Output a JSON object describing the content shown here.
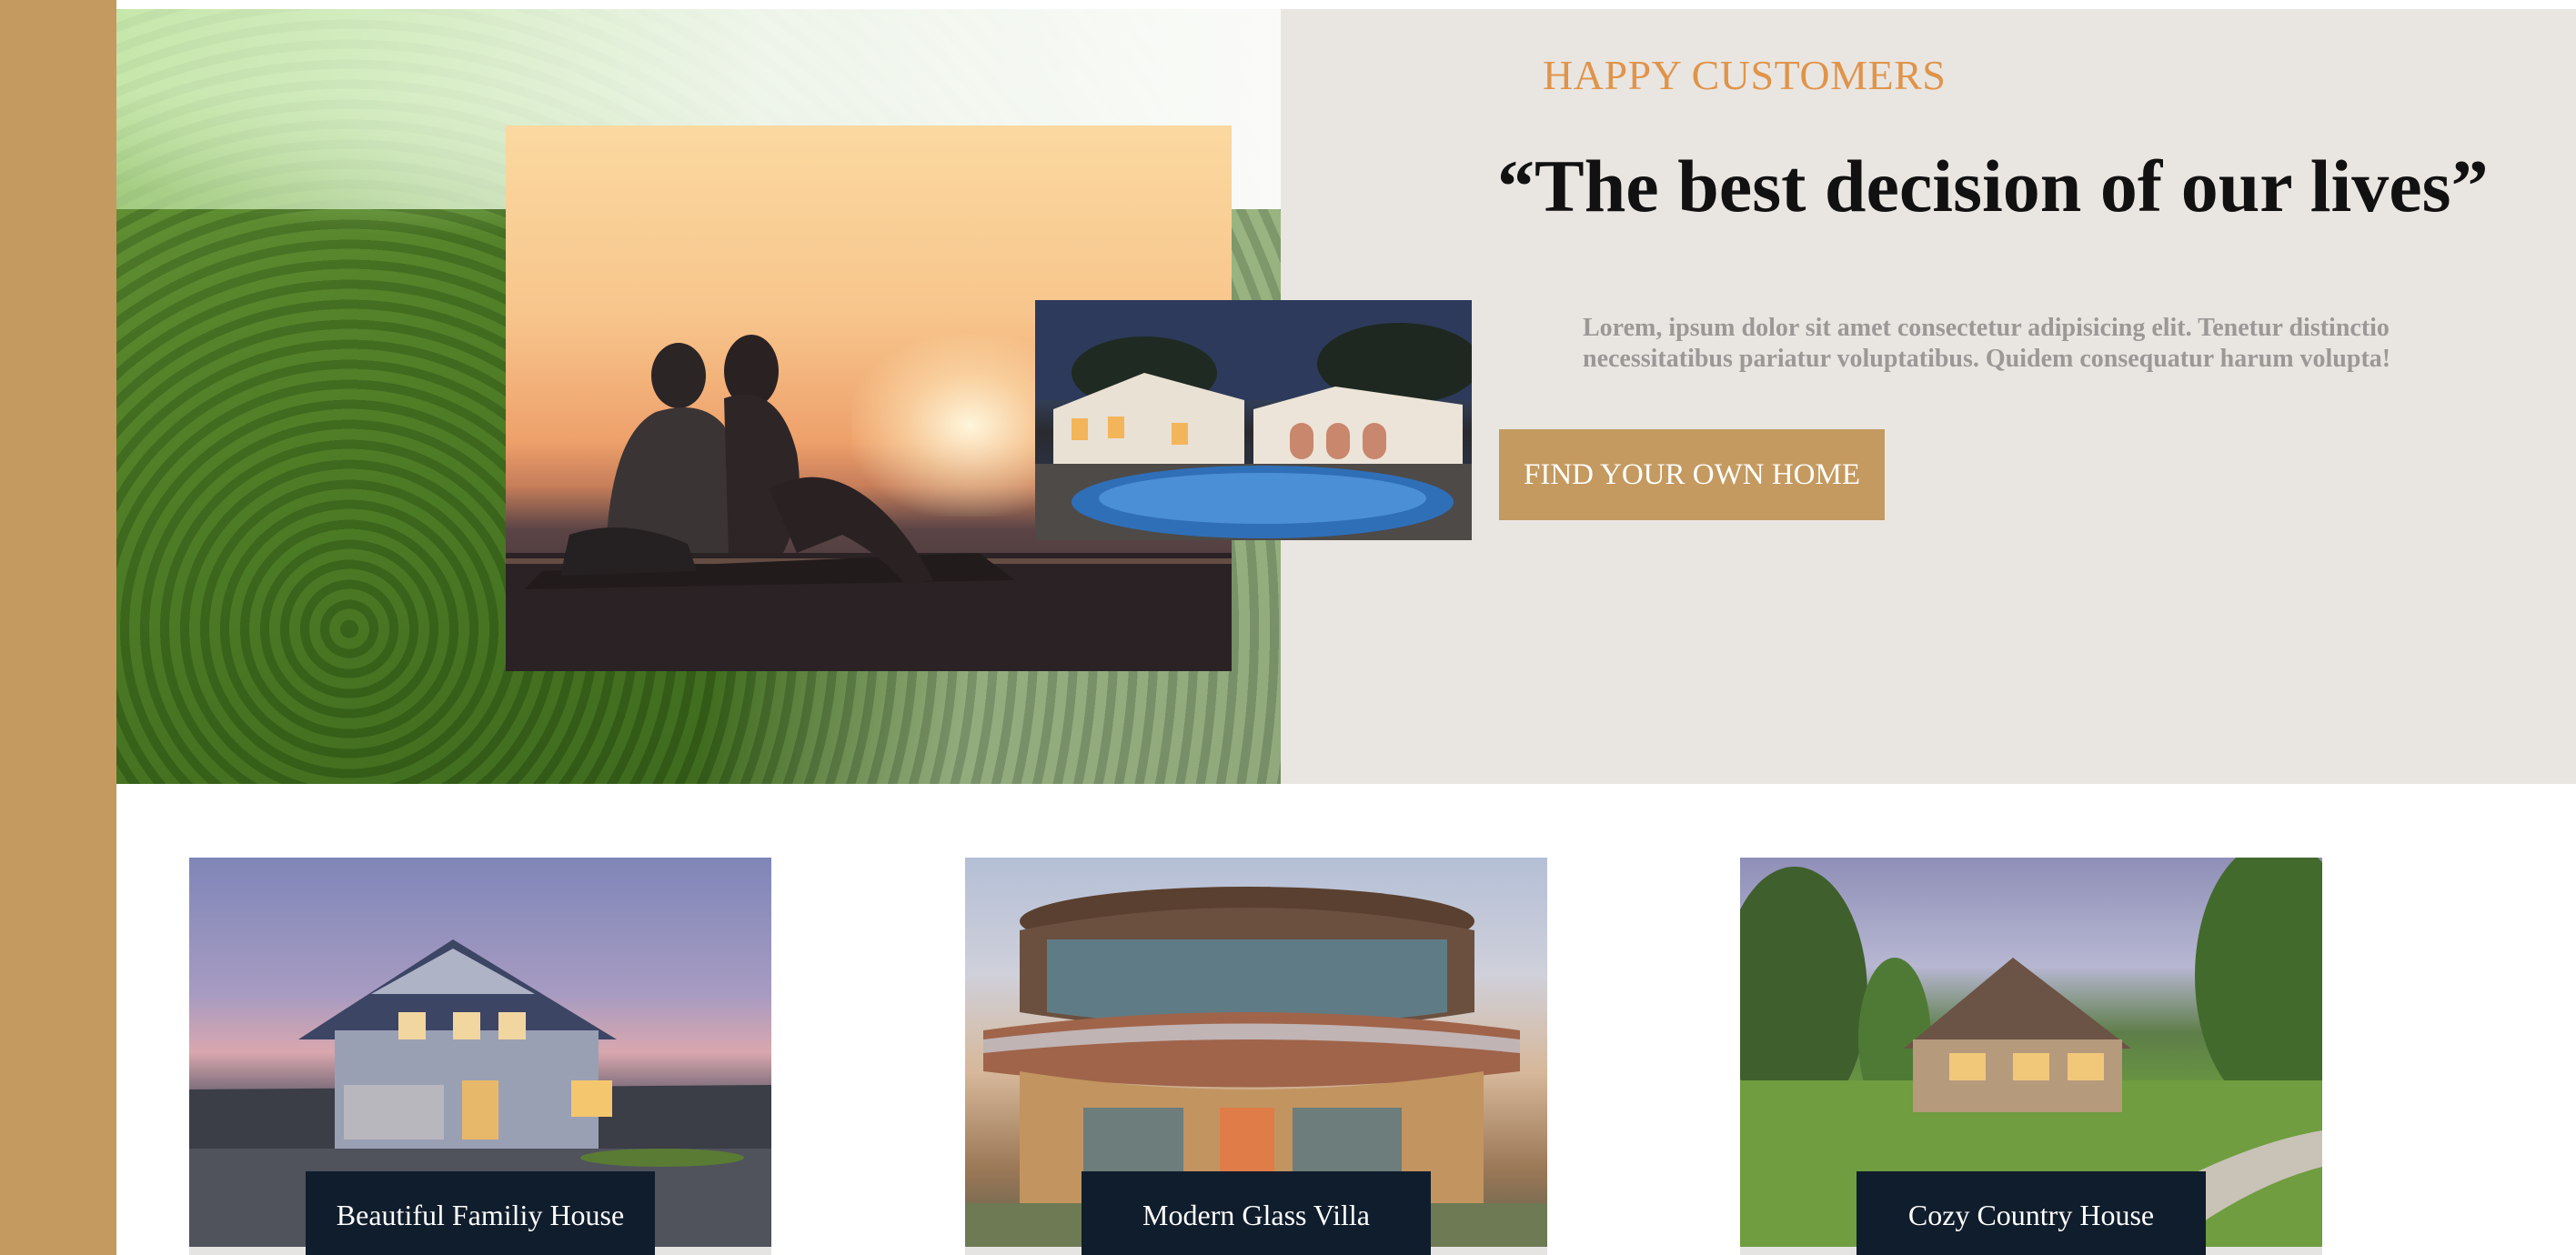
{
  "testimonial": {
    "eyebrow": "HAPPY CUSTOMERS",
    "headline": "“The best decision of our lives”",
    "body": "Lorem, ipsum dolor sit amet consectetur adipisicing elit. Tenetur distinctio necessitatibus pariatur voluptatibus. Quidem consequatur harum volupta!",
    "cta_label": "FIND YOUR OWN HOME"
  },
  "homes": [
    {
      "name": "Beautiful Familiy House"
    },
    {
      "name": "Modern Glass Villa"
    },
    {
      "name": "Cozy Country House"
    }
  ],
  "colors": {
    "accent": "#c49a60",
    "eyebrow": "#e0944a",
    "label_bg": "#101d2c",
    "panel_bg": "#e9e6e2"
  }
}
